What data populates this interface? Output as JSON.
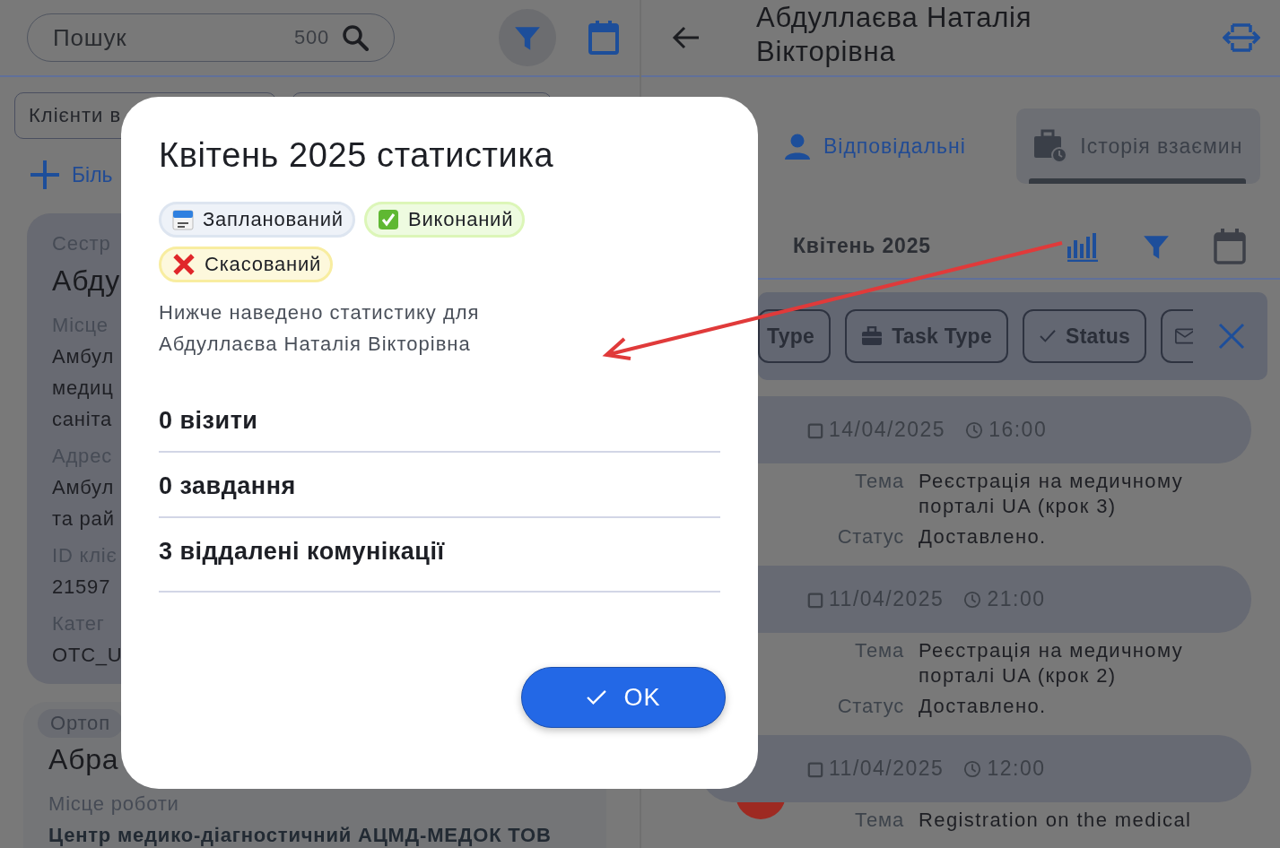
{
  "left_panel": {
    "search": {
      "placeholder": "Пошук",
      "count": "500"
    },
    "client_filter": "Клієнти в",
    "add_more": "Біль",
    "cards": [
      {
        "specialty": "Сестр",
        "name": "Абду",
        "fields": [
          {
            "label": "Місце",
            "value_lines": [
              "Амбул",
              "медиц",
              "саніта"
            ]
          },
          {
            "label": "Адрес",
            "value_lines": [
              "Амбул",
              "та рай"
            ]
          },
          {
            "label": "ID кліє",
            "value_lines": [
              "21597"
            ]
          },
          {
            "label": "Катег",
            "value_lines": [
              "OTC_U"
            ]
          }
        ]
      },
      {
        "specialty": "Ортоп",
        "name": "Абра",
        "fields": [
          {
            "label": "Місце роботи",
            "value_lines": [
              "Центр медико-діагностичний АЦМД-МЕДОК ТОВ"
            ]
          }
        ]
      }
    ]
  },
  "right_panel": {
    "title": "Абдуллаєва Наталія Вікторівна",
    "tabs": [
      {
        "label": "Відповідальні",
        "selected": false
      },
      {
        "label": "Історія взаємин",
        "selected": true
      }
    ],
    "month": "Квітень 2025",
    "filter_chips": [
      {
        "label": "Type",
        "kind": "plain"
      },
      {
        "label": "Task Type",
        "kind": "briefcase"
      },
      {
        "label": "Status",
        "kind": "check"
      },
      {
        "kind": "mail"
      }
    ],
    "entries": [
      {
        "date": "14/04/2025",
        "time": "16:00",
        "fields": [
          {
            "label": "Тема",
            "value_lines": [
              "Реєстрація на медичному",
              "порталі UA (крок 3)"
            ]
          },
          {
            "label": "Статус",
            "value_lines": [
              "Доставлено."
            ]
          }
        ]
      },
      {
        "date": "11/04/2025",
        "time": "21:00",
        "fields": [
          {
            "label": "Тема",
            "value_lines": [
              "Реєстрація на медичному",
              "порталі UA (крок 2)"
            ]
          },
          {
            "label": "Статус",
            "value_lines": [
              "Доставлено."
            ]
          }
        ]
      },
      {
        "date": "11/04/2025",
        "time": "12:00",
        "color": "#9e2a22",
        "fields": [
          {
            "label": "Тема",
            "value_lines": [
              "Registration on the medical"
            ]
          }
        ]
      }
    ]
  },
  "dialog": {
    "title": "Квітень 2025 статистика",
    "legend": [
      {
        "label": "Запланований",
        "kind": "planned"
      },
      {
        "label": "Виконаний",
        "kind": "done"
      },
      {
        "label": "Скасований",
        "kind": "cancelled"
      }
    ],
    "description": "Нижче наведено статистику для Абдуллаєва Наталія Вікторівна",
    "stats": [
      "0 візити",
      "0 завдання",
      "3 віддалені комунікації"
    ],
    "ok_button": "OK"
  }
}
